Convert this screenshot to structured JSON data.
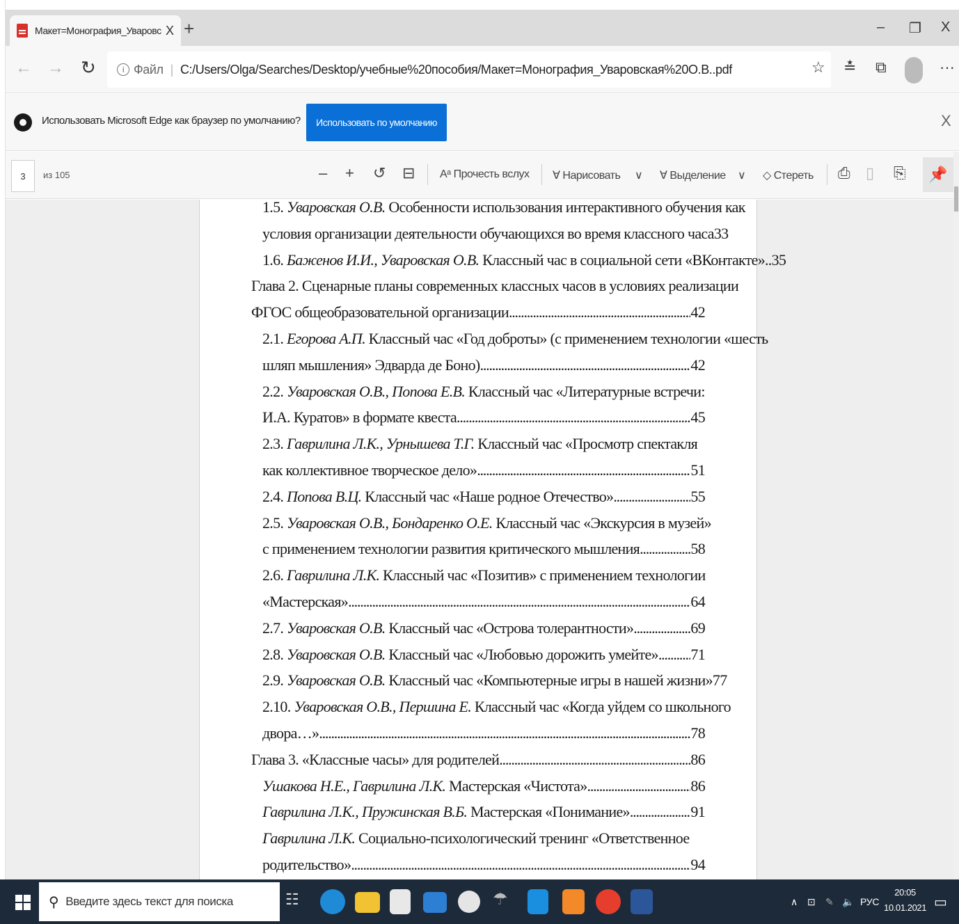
{
  "browser": {
    "tab_title": "Макет=Монография_Уваровск",
    "tab_close": "X",
    "new_tab": "+",
    "window_minimize": "–",
    "window_restore": "❐",
    "window_close": "X",
    "file_label": "Файл",
    "address": "C:/Users/Olga/Searches/Desktop/учебные%20пособия/Макет=Монография_Уваровская%20О.В..pdf",
    "more": "···"
  },
  "infobar": {
    "message": "Использовать Microsoft Edge как браузер по умолчанию?",
    "button": "Использовать по умолчанию",
    "close": "X"
  },
  "pdf_toolbar": {
    "page_current": "3",
    "page_total": "из 105",
    "zoom_out": "–",
    "zoom_in": "+",
    "read_aloud": "Прочесть вслух",
    "draw": "Нарисовать",
    "highlight": "Выделение",
    "erase": "Стереть"
  },
  "toc": [
    {
      "num": "1.5.",
      "author": "Уваровская О.В.",
      "text": " Особенности использования интерактивного обучения как",
      "page": "",
      "indent": true
    },
    {
      "num": "",
      "author": "",
      "text": "условия организации деятельности обучающихся во время классного часа",
      "page": "33",
      "indent": true
    },
    {
      "num": "1.6.",
      "author": "Баженов И.И., Уваровская О.В.",
      "text": " Классный час в социальной сети «ВКонтакте»..",
      "page": "35",
      "indent": true
    },
    {
      "num": "",
      "author": "",
      "text": "Глава 2. Сценарные планы современных классных часов в условиях реализации",
      "page": "",
      "indent": false
    },
    {
      "num": "",
      "author": "",
      "text": "ФГОС общеобразовательной организации",
      "page": "42",
      "indent": false
    },
    {
      "num": "2.1.",
      "author": "Егорова А.П.",
      "text": " Классный час «Год доброты» (с применением технологии «шесть",
      "page": "",
      "indent": true
    },
    {
      "num": "",
      "author": "",
      "text": "шляп мышления» Эдварда де Боно)",
      "page": "42",
      "indent": true
    },
    {
      "num": "2.2.",
      "author": "Уваровская О.В., Попова Е.В.",
      "text": " Классный час «Литературные встречи:",
      "page": "",
      "indent": true
    },
    {
      "num": "",
      "author": "",
      "text": "И.А. Куратов» в формате квеста",
      "page": "45",
      "indent": true
    },
    {
      "num": "2.3.",
      "author": "Гаврилина Л.К., Урнышева Т.Г.",
      "text": " Классный час «Просмотр спектакля",
      "page": "",
      "indent": true
    },
    {
      "num": "",
      "author": "",
      "text": "как коллективное творческое дело»",
      "page": "51",
      "indent": true
    },
    {
      "num": "2.4.",
      "author": "Попова В.Ц.",
      "text": " Классный час «Наше родное Отечество»",
      "page": "55",
      "indent": true
    },
    {
      "num": "2.5.",
      "author": "Уваровская О.В., Бондаренко О.Е.",
      "text": " Классный час «Экскурсия в музей»",
      "page": "",
      "indent": true
    },
    {
      "num": "",
      "author": "",
      "text": "с применением технологии развития критического мышления",
      "page": "58",
      "indent": true
    },
    {
      "num": "2.6.",
      "author": "Гаврилина Л.К.",
      "text": " Классный час «Позитив» с применением технологии",
      "page": "",
      "indent": true
    },
    {
      "num": "",
      "author": "",
      "text": "«Мастерская»",
      "page": "64",
      "indent": true
    },
    {
      "num": "2.7.",
      "author": "Уваровская О.В.",
      "text": " Классный час «Острова толерантности»",
      "page": "69",
      "indent": true
    },
    {
      "num": "2.8.",
      "author": "Уваровская О.В.",
      "text": " Классный час «Любовью дорожить умейте»",
      "page": "71",
      "indent": true
    },
    {
      "num": "2.9.",
      "author": "Уваровская О.В.",
      "text": " Классный час «Компьютерные игры в нашей жизни»",
      "page": "77",
      "indent": true
    },
    {
      "num": "2.10.",
      "author": "Уваровская О.В., Першина Е.",
      "text": " Классный час «Когда уйдем со школьного",
      "page": "",
      "indent": true
    },
    {
      "num": "",
      "author": "",
      "text": "двора…»",
      "page": "78",
      "indent": true
    },
    {
      "num": "",
      "author": "",
      "text": "Глава 3. «Классные часы» для родителей",
      "page": "86",
      "indent": false
    },
    {
      "num": "",
      "author": "Ушакова Н.Е., Гаврилина Л.К.",
      "text": " Мастерская «Чистота»",
      "page": "86",
      "indent": true
    },
    {
      "num": "",
      "author": "Гаврилина Л.К., Пружинская В.Б.",
      "text": " Мастерская «Понимание»",
      "page": "91",
      "indent": true
    },
    {
      "num": "",
      "author": "Гаврилина Л.К.",
      "text": " Социально-психологический тренинг «Ответственное",
      "page": "",
      "indent": true
    },
    {
      "num": "",
      "author": "",
      "text": "родительство»",
      "page": "94",
      "indent": true
    }
  ],
  "taskbar": {
    "search_placeholder": "Введите здесь текст для поиска",
    "lang": "РУС",
    "time": "20:05",
    "date": "10.01.2021"
  },
  "colors": {
    "accent": "#0a6fd6",
    "taskbar": "#1d2a3a"
  }
}
